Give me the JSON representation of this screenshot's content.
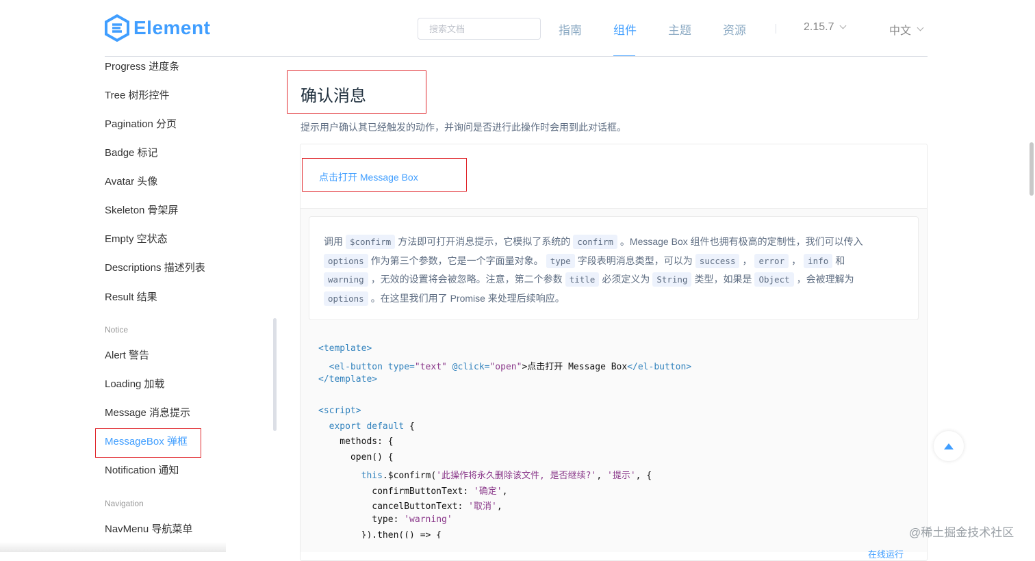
{
  "header": {
    "logo_text": "Element",
    "search_placeholder": "搜索文档",
    "nav": [
      "指南",
      "组件",
      "主题",
      "资源"
    ],
    "version": "2.15.7",
    "language": "中文"
  },
  "sidebar": {
    "items_top": [
      "Progress 进度条",
      "Tree 树形控件",
      "Pagination 分页",
      "Badge 标记",
      "Avatar 头像",
      "Skeleton 骨架屏",
      "Empty 空状态",
      "Descriptions 描述列表",
      "Result 结果"
    ],
    "group_notice": "Notice",
    "items_notice": [
      "Alert 警告",
      "Loading 加载",
      "Message 消息提示",
      "MessageBox 弹框",
      "Notification 通知"
    ],
    "group_navigation": "Navigation",
    "items_navigation": [
      "NavMenu 导航菜单"
    ]
  },
  "main": {
    "title": "确认消息",
    "description": "提示用户确认其已经触发的动作，并询问是否进行此操作时会用到此对话框。",
    "demo_button": "点击打开 Message Box",
    "meta": {
      "l1": [
        "调用",
        "$confirm",
        "方法即可打开消息提示，它模拟了系统的",
        "confirm",
        "。Message Box 组件也拥有极高的定制性，我们可以传入"
      ],
      "l2": [
        "options",
        "作为第三个参数，它是一个字面量对象。",
        "type",
        "字段表明消息类型，可以为",
        "success",
        "，",
        "error",
        "，",
        "info",
        "和"
      ],
      "l3": [
        "warning",
        "，无效的设置将会被忽略。注意，第二个参数",
        "title",
        "必须定义为",
        "String",
        "类型，如果是",
        "Object",
        "，会被理解为"
      ],
      "l4": [
        "options",
        "。在这里我们用了 Promise 来处理后续响应。"
      ]
    },
    "code": {
      "c1": "<template>",
      "c2a": "  <el-button ",
      "c2b": "type=",
      "c2c": "\"text\"",
      "c2d": " @click=",
      "c2e": "\"open\"",
      "c2f": ">点击打开 Message Box",
      "c2g": "</el-button>",
      "c3": "</template>",
      "c4": "<script>",
      "c5a": "  export default",
      "c5b": " {",
      "c6": "    methods: {",
      "c7": "      open() {",
      "c8a": "        this",
      "c8b": ".$confirm(",
      "c8c": "'此操作将永久删除该文件, 是否继续?'",
      "c8d": ", ",
      "c8e": "'提示'",
      "c8f": ", {",
      "c9a": "          confirmButtonText: ",
      "c9b": "'确定'",
      "c9c": ",",
      "c10a": "          cancelButtonText: ",
      "c10b": "'取消'",
      "c10c": ",",
      "c11a": "          type: ",
      "c11b": "'warning'",
      "c12": "        }).then(() => {"
    },
    "run_link": "在线运行"
  },
  "watermark": "@稀土掘金技术社区"
}
